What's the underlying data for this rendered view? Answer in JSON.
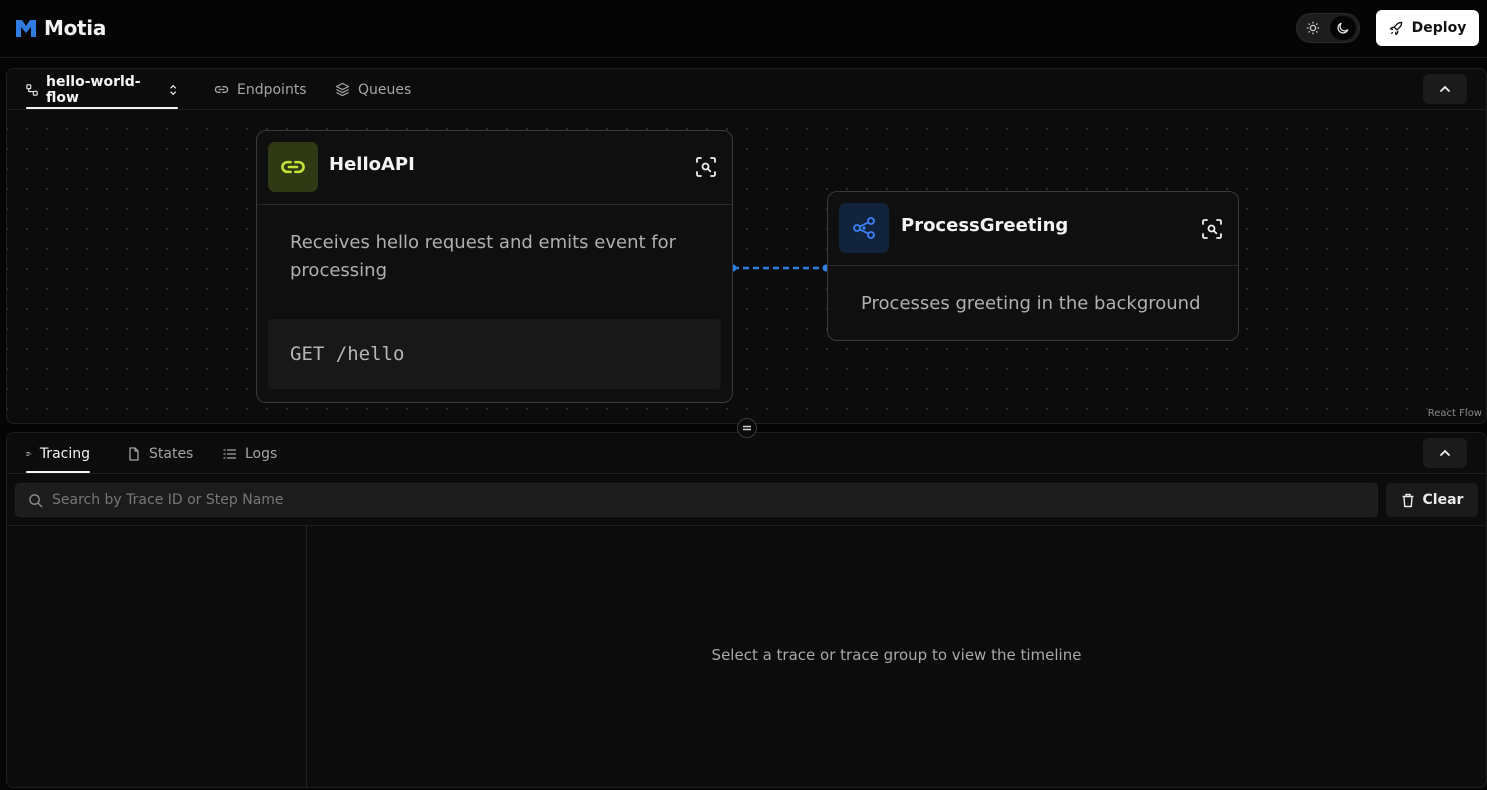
{
  "app": {
    "name": "Motia"
  },
  "header": {
    "deploy_label": "Deploy",
    "theme_options": [
      "sun-icon",
      "moon-icon"
    ],
    "theme_active": "moon"
  },
  "flow": {
    "tabs": [
      {
        "label": "hello-world-flow",
        "icon": "flow-icon",
        "active": true
      },
      {
        "label": "Endpoints",
        "icon": "link-icon",
        "active": false
      },
      {
        "label": "Queues",
        "icon": "layers-icon",
        "active": false
      }
    ],
    "nodes": [
      {
        "title": "HelloAPI",
        "icon": "link-icon",
        "accent": "#c6e23a",
        "description": "Receives hello request and emits event for processing",
        "code": "GET /hello"
      },
      {
        "title": "ProcessGreeting",
        "icon": "share-icon",
        "accent": "#3b82f6",
        "description": "Processes greeting in the background"
      }
    ],
    "edge_color": "#2f7de1",
    "attribution": "React Flow"
  },
  "bottom": {
    "tabs": [
      {
        "label": "Tracing",
        "icon": "tracing-icon",
        "active": true
      },
      {
        "label": "States",
        "icon": "file-icon",
        "active": false
      },
      {
        "label": "Logs",
        "icon": "list-icon",
        "active": false
      }
    ],
    "search_placeholder": "Search by Trace ID or Step Name",
    "clear_label": "Clear",
    "empty_message": "Select a trace or trace group to view the timeline"
  }
}
